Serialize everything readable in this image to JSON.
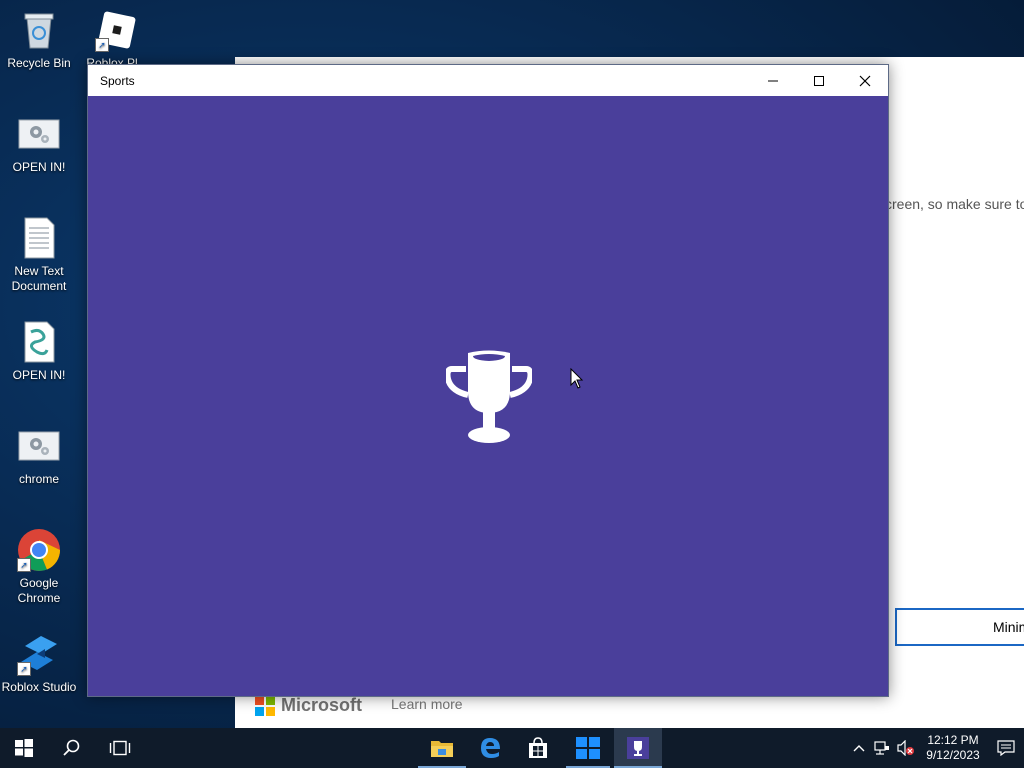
{
  "desktop": {
    "icons": [
      {
        "label": "Recycle Bin"
      },
      {
        "label": "Roblox Pl..."
      },
      {
        "label": "OPEN IN!"
      },
      {
        "label": "New Text Document"
      },
      {
        "label": "OPEN IN!"
      },
      {
        "label": "chrome"
      },
      {
        "label": "Google Chrome"
      },
      {
        "label": "Roblox Studio"
      }
    ]
  },
  "background_window": {
    "text_fragment": "creen, so make sure to",
    "button_label": "Minimize",
    "brand": "Microsoft",
    "link": "Learn more"
  },
  "app_window": {
    "title": "Sports",
    "background_color": "#4a3f9b",
    "splash_icon": "trophy-icon"
  },
  "taskbar": {
    "pinned": [
      "start-icon",
      "search-icon",
      "task-view-icon",
      "file-explorer-icon",
      "edge-icon",
      "store-icon",
      "windows-app-icon",
      "sports-app-icon"
    ],
    "clock_time": "12:12 PM",
    "clock_date": "9/12/2023"
  }
}
